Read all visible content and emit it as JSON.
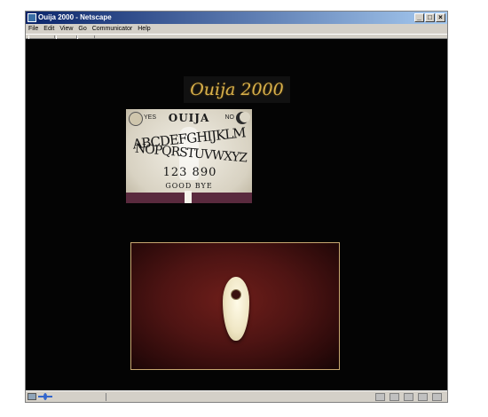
{
  "window": {
    "title": "Ouija 2000 - Netscape",
    "controls": {
      "minimize": "_",
      "maximize": "□",
      "close": "×"
    }
  },
  "menu": [
    "File",
    "Edit",
    "View",
    "Go",
    "Communicator",
    "Help"
  ],
  "page": {
    "logo_text": "Ouija 2000",
    "board": {
      "yes": "YES",
      "no": "NO",
      "brand": "OUIJA",
      "row1": "ABCDEFGHIJKLM",
      "row2": "NOPQRSTUVWXYZ",
      "digits": "123   890",
      "goodbye": "GOOD BYE"
    }
  },
  "icons": [
    "app-icon",
    "security-icon",
    "connection-icon",
    "navigator-icon",
    "mail-icon",
    "discussion-icon",
    "composer-icon",
    "check-icon"
  ],
  "colors": {
    "page_background": "#040404",
    "logo_gold": "#d9b24c",
    "table_red": "#4e1413",
    "planchette": "#efe6c4"
  }
}
